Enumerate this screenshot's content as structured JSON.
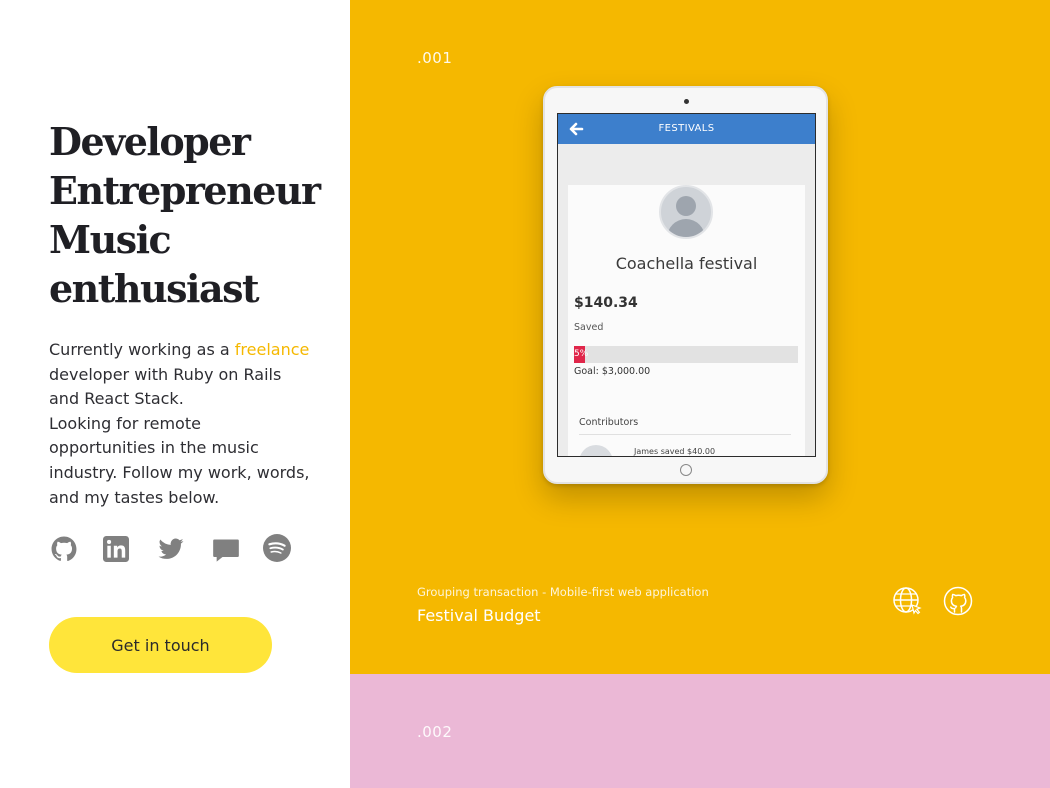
{
  "intro": {
    "headline": [
      "Developer",
      "Entrepreneur",
      "Music",
      "enthusiast"
    ],
    "bio": {
      "before": "Currently working as a ",
      "accent": "freelance",
      "after": " developer with Ruby on Rails and React Stack.",
      "second": "Looking for remote opportunities in the music industry. Follow my work, words, and my tastes below."
    },
    "accent_color": "#f5b800"
  },
  "socials": [
    {
      "icon": "github-icon"
    },
    {
      "icon": "linkedin-icon"
    },
    {
      "icon": "twitter-icon"
    },
    {
      "icon": "chat-icon"
    },
    {
      "icon": "spotify-icon"
    }
  ],
  "cta": {
    "label": "Get in touch",
    "color": "#ffe53a"
  },
  "projects": [
    {
      "number": ".001",
      "color": "#f5b800",
      "subtitle": "Grouping transaction - Mobile-first web application",
      "title": "Festival Budget",
      "actions": [
        "globe-icon",
        "github-icon"
      ],
      "mockup": {
        "header": "FESTIVALS",
        "event": "Coachella festival",
        "amount": "$140.34",
        "saved_label": "Saved",
        "progress_label": "5%",
        "progress_fraction": 0.05,
        "goal": "Goal: $3,000.00",
        "contributors_label": "Contributors",
        "contributor_entry": "James saved $40.00"
      }
    },
    {
      "number": ".002",
      "color": "#ebb8d6"
    }
  ]
}
